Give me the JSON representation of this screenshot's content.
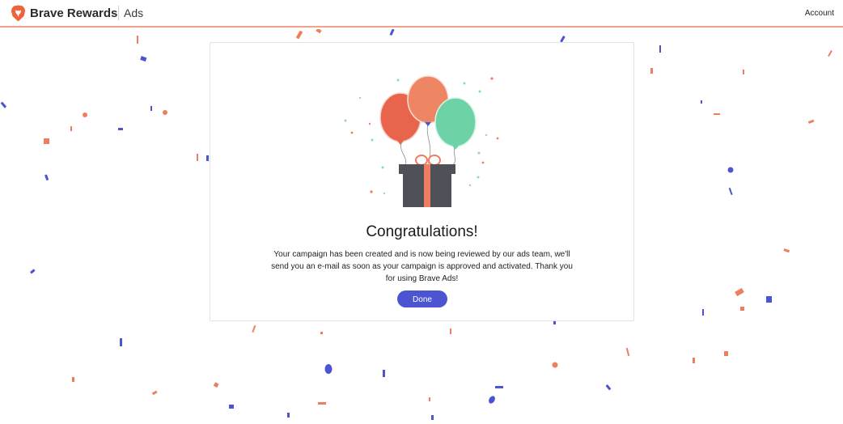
{
  "header": {
    "brand": "Brave Rewards",
    "product": "Ads",
    "account_label": "Account",
    "logo_icon": "brave-lion-icon"
  },
  "card": {
    "title": "Congratulations!",
    "message": "Your campaign has been created and is now being reviewed by our ads team, we'll send you an e-mail as soon as your campaign is approved and activated. Thank you for using Brave Ads!",
    "done_label": "Done",
    "illustration_icon": "balloons-gift-icon"
  },
  "colors": {
    "accent": "#4c54d2",
    "brand_orange": "#f0623c",
    "header_border": "#f1a489",
    "confetti_blue": "#4c54d2",
    "confetti_orange": "#ef7d5f",
    "balloon_red": "#e8644d",
    "balloon_salmon": "#ee8563",
    "balloon_green": "#6dd3a6",
    "gift_box": "#505058"
  }
}
